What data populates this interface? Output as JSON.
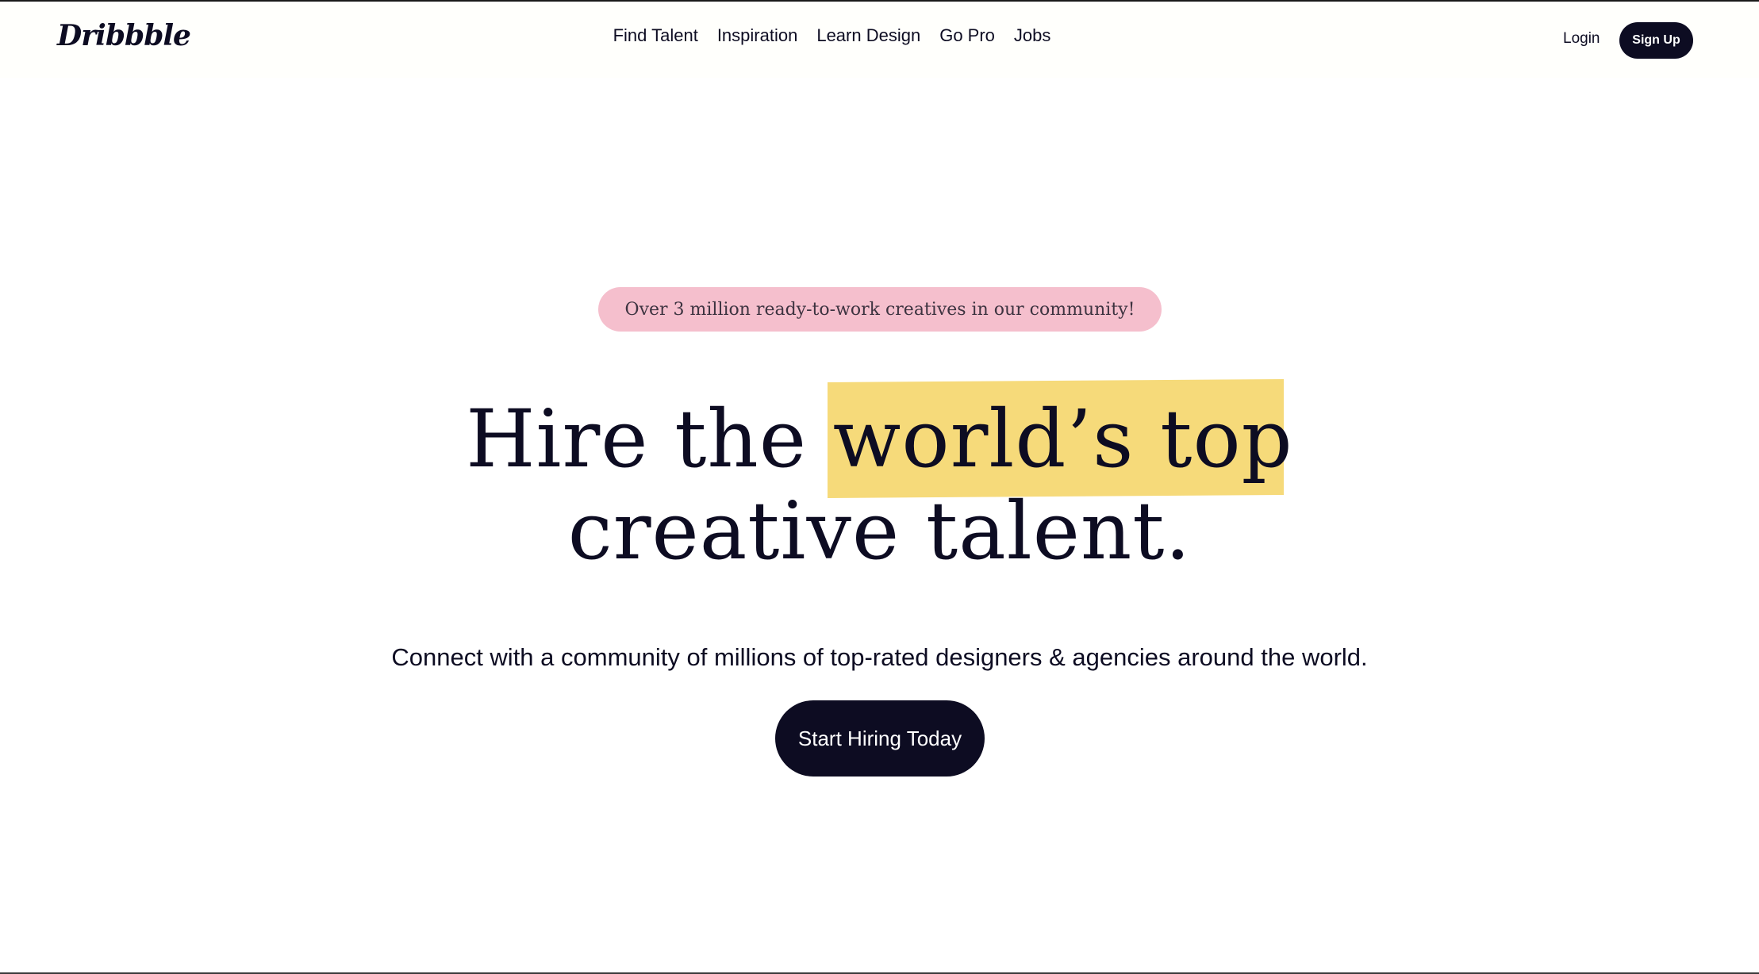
{
  "header": {
    "logo_text": "Dribbble",
    "nav": [
      {
        "label": "Find Talent"
      },
      {
        "label": "Inspiration"
      },
      {
        "label": "Learn Design"
      },
      {
        "label": "Go Pro"
      },
      {
        "label": "Jobs"
      }
    ],
    "login_label": "Login",
    "signup_label": "Sign Up"
  },
  "hero": {
    "badge_text": "Over 3 million ready-to-work creatives in our community!",
    "headline_plain": "Hire the ",
    "headline_highlight": "world’s top",
    "headline_line2": "creative talent.",
    "subheading": "Connect with a community of millions of top-rated designers & agencies around the world.",
    "cta_label": "Start Hiring Today"
  },
  "colors": {
    "text_dark": "#0d0c22",
    "badge_pink": "#f5bfcd",
    "highlight_yellow": "#f6da7a",
    "button_dark": "#0d0c22"
  }
}
